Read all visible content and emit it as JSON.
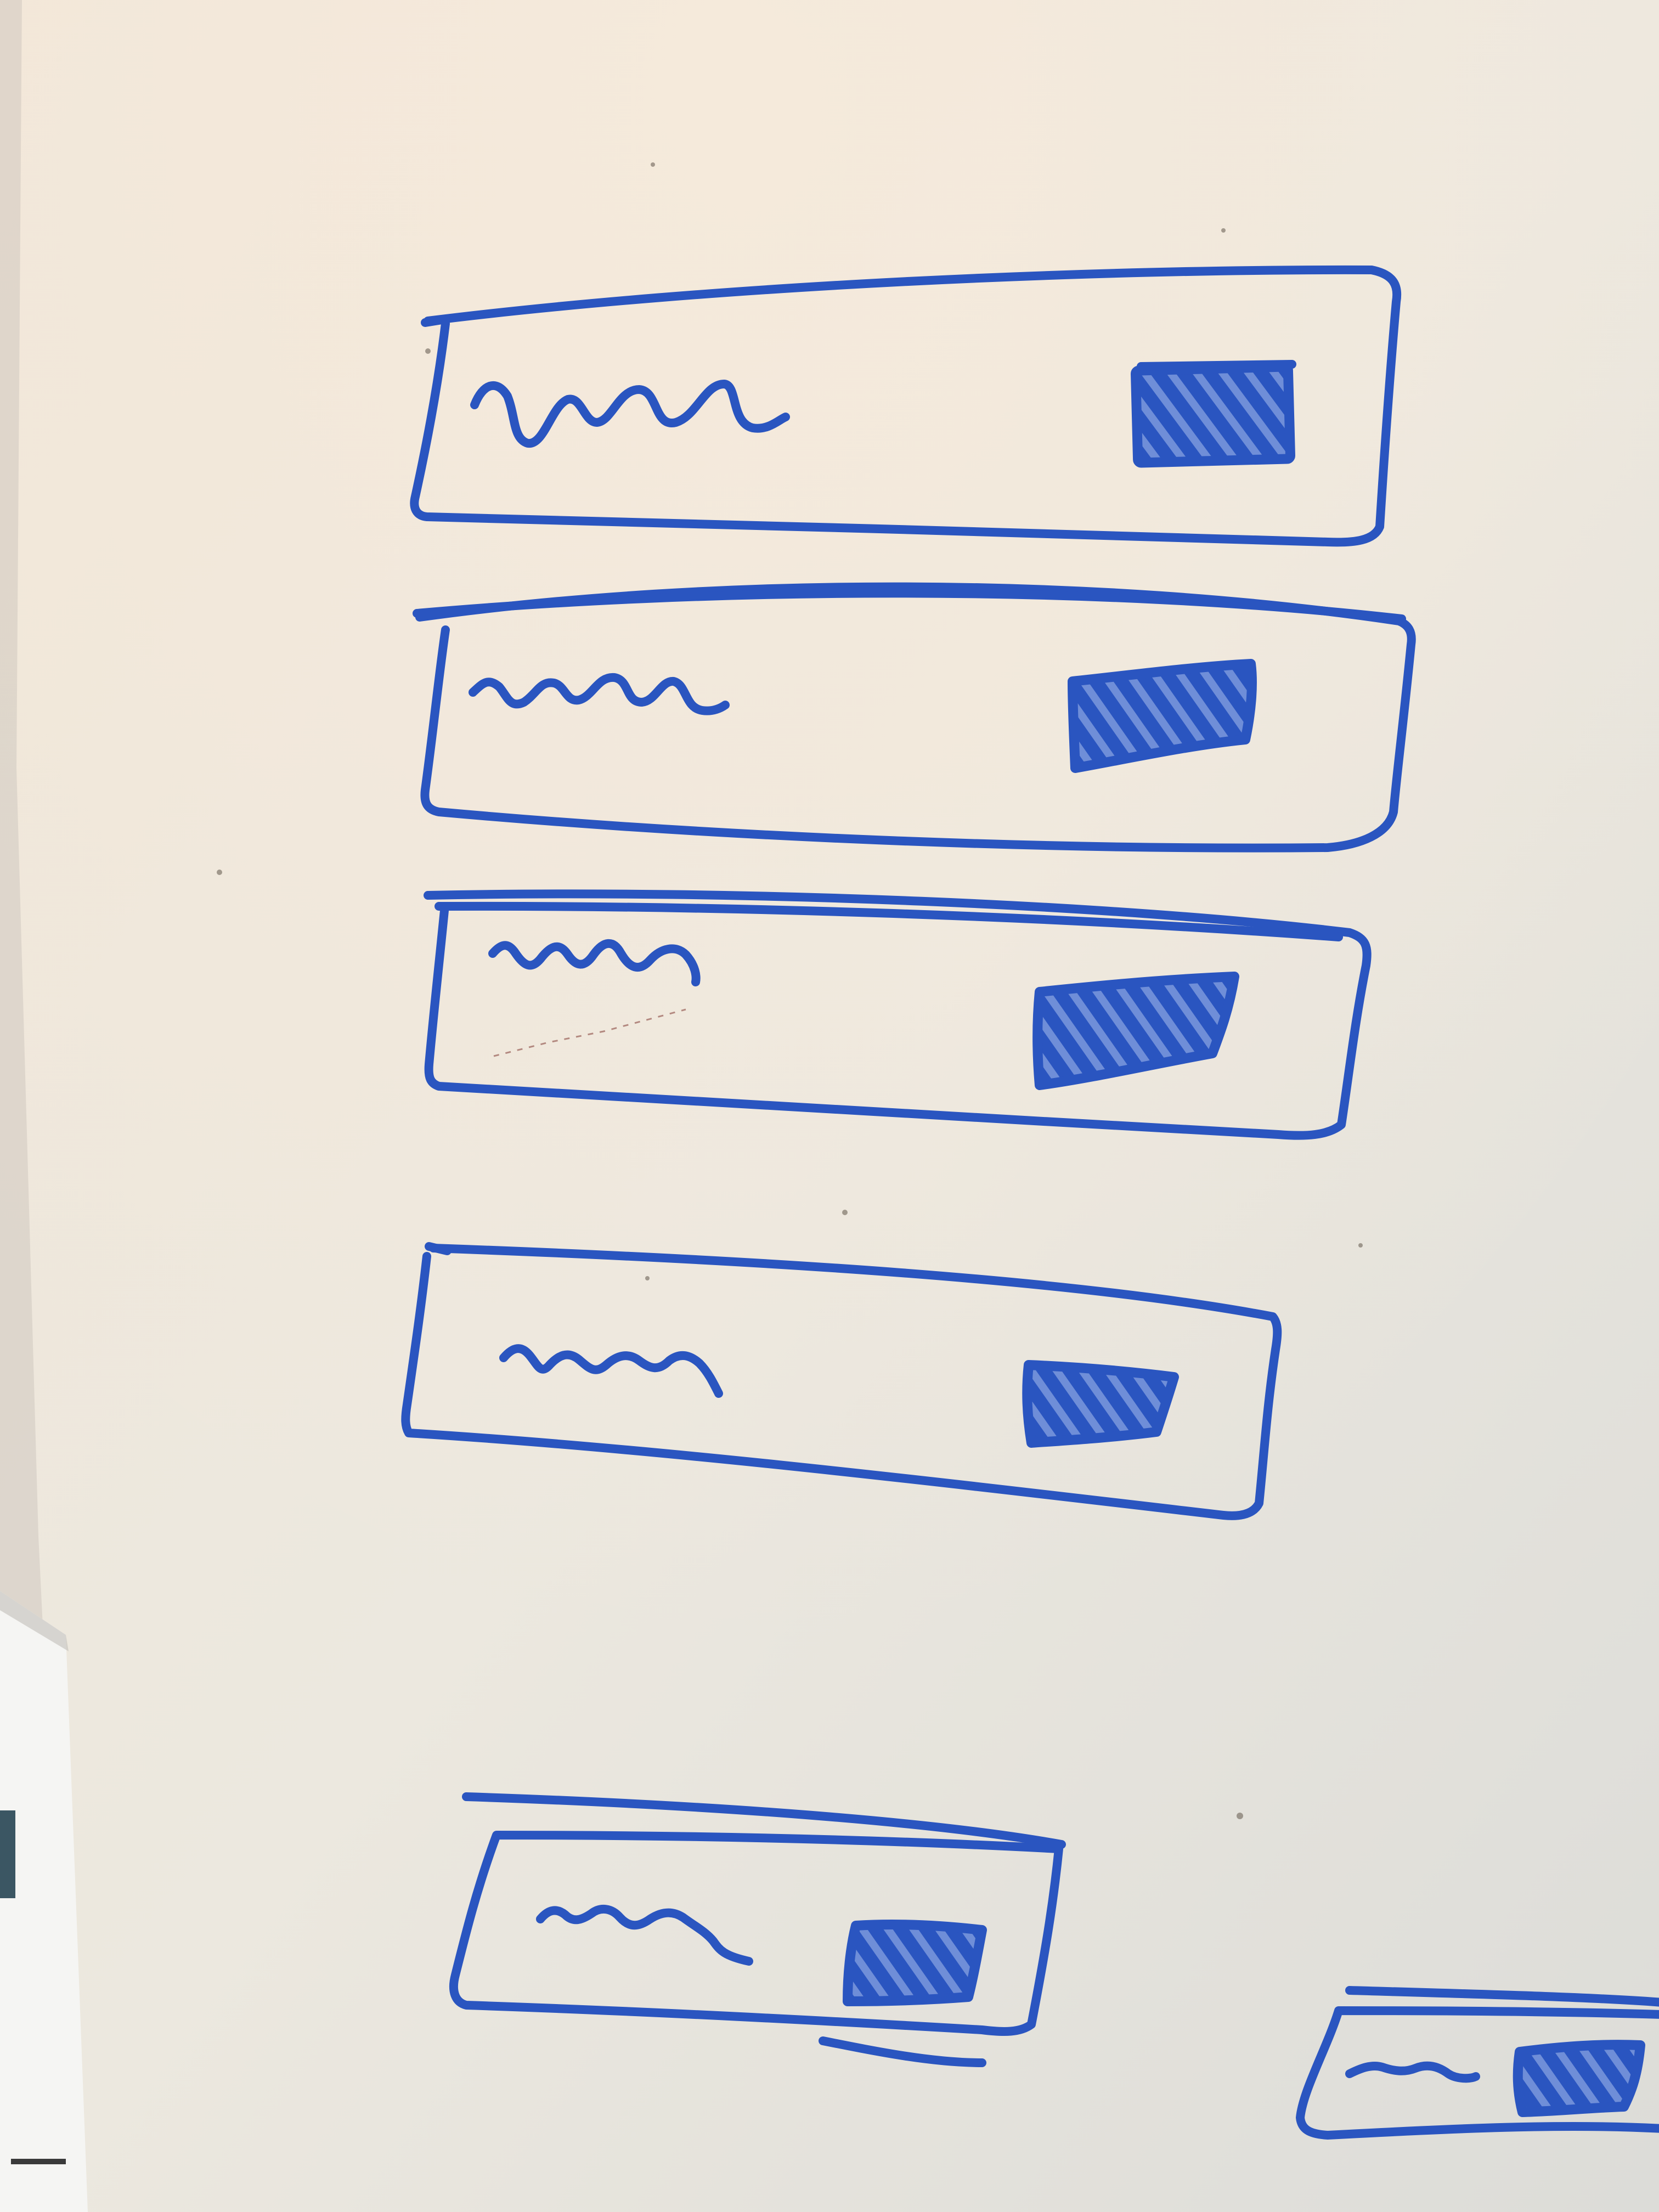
{
  "whiteboard": {
    "colors": {
      "marker": "#2a55c0",
      "board_light": "#efe9dd",
      "board_shadow": "#d8d4cc",
      "paper_edge": "#f4f4f2"
    },
    "sketch": {
      "element": "list-item",
      "text_placeholder": "scribble-line",
      "thumbnail": "hatched-rectangle",
      "item_count": 6
    }
  }
}
